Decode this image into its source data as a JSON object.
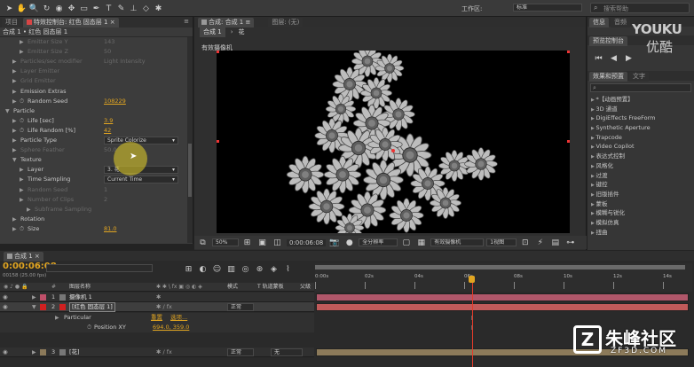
{
  "app": {
    "workspace_label": "工作区:",
    "workspace_value": "标准",
    "search_placeholder": "搜索帮助"
  },
  "colors": {
    "accent": "#e1a521",
    "bg": "#232323",
    "panel": "#3a3a3a",
    "layer_bar": "#b0576a",
    "layer_bar_tan": "#8c7a5a",
    "playhead": "#e33b2a"
  },
  "left_panel": {
    "tabs": [
      "项目",
      "特效控制台: 红色 固态层 1"
    ],
    "breadcrumb": "合成 1 • 红色 固态层 1",
    "rows": [
      {
        "label": "Emitter Size Y",
        "value": "143",
        "dim": true,
        "indent": 2
      },
      {
        "label": "Emitter Size Z",
        "value": "50",
        "dim": true,
        "indent": 2
      },
      {
        "label": "Particles/sec modifier",
        "value": "Light Intensity",
        "dim": true,
        "indent": 1
      },
      {
        "label": "Layer Emitter",
        "value": "",
        "dim": true,
        "indent": 1
      },
      {
        "label": "Grid Emitter",
        "value": "",
        "dim": true,
        "indent": 1
      },
      {
        "label": "Emission Extras",
        "value": "",
        "dim": false,
        "indent": 1
      },
      {
        "label": "Random Seed",
        "value": "108229",
        "dim": false,
        "indent": 1,
        "stopwatch": true
      },
      {
        "label": "Particle",
        "value": "",
        "dim": false,
        "indent": 0,
        "open": true
      },
      {
        "label": "Life [sec]",
        "value": "3.9",
        "dim": false,
        "indent": 1,
        "stopwatch": true
      },
      {
        "label": "Life Random [%]",
        "value": "42",
        "dim": false,
        "indent": 1,
        "stopwatch": true
      },
      {
        "label": "Particle Type",
        "value": "",
        "dim": false,
        "indent": 1,
        "dropdown": "Sprite Colorize"
      },
      {
        "label": "Sphere Feather",
        "value": "50.0",
        "dim": true,
        "indent": 1
      },
      {
        "label": "Texture",
        "value": "",
        "dim": false,
        "indent": 1,
        "open": true
      },
      {
        "label": "Layer",
        "value": "",
        "dim": false,
        "indent": 2,
        "dropdown": "3. 花"
      },
      {
        "label": "Time Sampling",
        "value": "",
        "dim": false,
        "indent": 2,
        "dropdown": "Current Time"
      },
      {
        "label": "Random Seed",
        "value": "1",
        "dim": true,
        "indent": 2
      },
      {
        "label": "Number of Clips",
        "value": "2",
        "dim": true,
        "indent": 2
      },
      {
        "label": "Subframe Sampling",
        "value": "",
        "dim": true,
        "indent": 3
      },
      {
        "label": "Rotation",
        "value": "",
        "dim": false,
        "indent": 1
      },
      {
        "label": "Size",
        "value": "81.0",
        "dim": false,
        "indent": 1,
        "stopwatch": true
      }
    ]
  },
  "composition": {
    "tabs": [
      "合成: 合成 1",
      "图层: (无)"
    ],
    "crumbs": [
      "合成 1",
      "花"
    ],
    "camera_label": "有效摄像机",
    "zoom": "50%",
    "timecode": "0:00:06:08",
    "resolution": "全分辨率",
    "camera_view": "有效摄像机",
    "views": "1视图"
  },
  "right_panel": {
    "info_tabs": [
      "信息",
      "音频"
    ],
    "preview_tab": "预览控制台",
    "effects_tabs": [
      "效果和预置",
      "文字"
    ],
    "effects_search": "",
    "categories": [
      "*【动画预置】",
      "3D 通道",
      "DigiEffects FreeForm",
      "Synthetic Aperture",
      "Trapcode",
      "Video Copilot",
      "表达式控制",
      "风格化",
      "过渡",
      "键控",
      "旧版插件",
      "蒙板",
      "模糊与锐化",
      "模拟仿真",
      "扭曲"
    ]
  },
  "timeline": {
    "tab": "合成 1",
    "timecode": "0:00:06:08",
    "frames": "00158 (25.00 fps)",
    "header": {
      "source": "图层名称",
      "mode": "模式",
      "trkmat": "T 轨道蒙板",
      "parent": "父级"
    },
    "ruler": [
      "0:00s",
      "02s",
      "04s",
      "06s",
      "08s",
      "10s",
      "12s",
      "14s"
    ],
    "layers": [
      {
        "num": "1",
        "name": "摄像机 1",
        "color": "#c0506a",
        "type": "camera"
      },
      {
        "num": "2",
        "name": "[红色 固态层 1]",
        "color": "#d02020",
        "type": "solid",
        "mode": "正常"
      },
      {
        "num": "3",
        "name": "[花]",
        "color": "#8c7a5a",
        "type": "comp",
        "mode": "正常",
        "parent": "无"
      }
    ],
    "sub_effect": "Particular",
    "sub_reset": "重置",
    "sub_options": "选项...",
    "sub_prop": "Position XY",
    "sub_prop_value": "694.0, 359.0"
  },
  "watermarks": {
    "youku": "YOUKU",
    "youku_cn": "优酷",
    "site_cn": "朱峰社区",
    "site": "ZF3D.COM"
  }
}
